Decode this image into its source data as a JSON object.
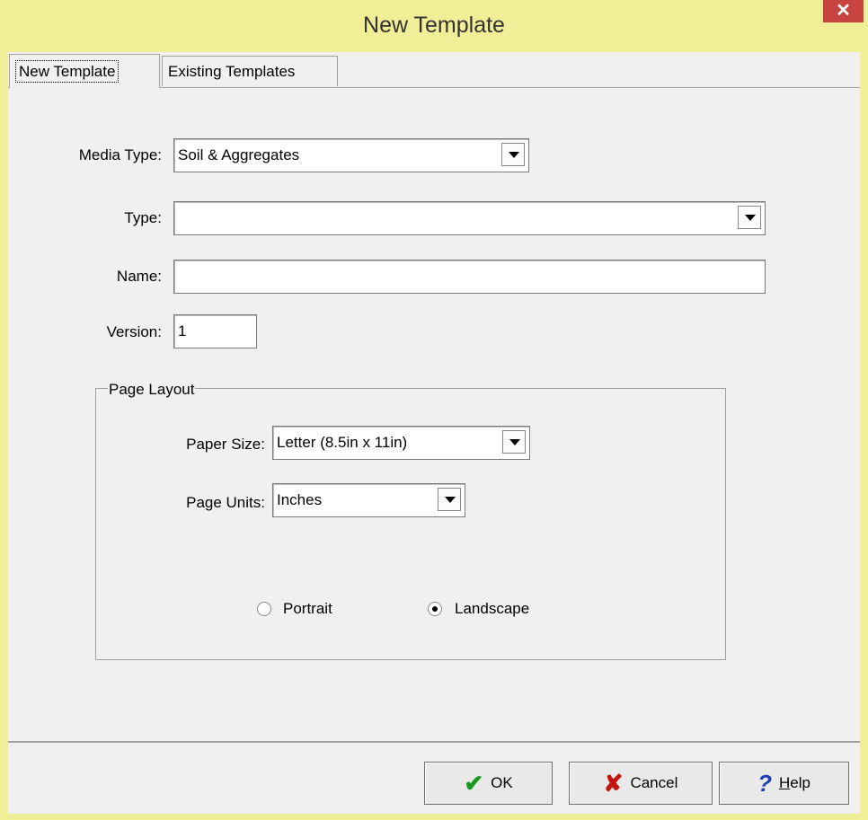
{
  "window": {
    "title": "New Template",
    "close_glyph": "✕"
  },
  "tabs": [
    {
      "label": "New Template",
      "selected": true
    },
    {
      "label": "Existing Templates",
      "selected": false
    }
  ],
  "form": {
    "media_type": {
      "label": "Media Type:",
      "value": "Soil & Aggregates"
    },
    "type": {
      "label": "Type:",
      "value": ""
    },
    "name": {
      "label": "Name:",
      "value": ""
    },
    "version": {
      "label": "Version:",
      "value": "1"
    }
  },
  "page_layout": {
    "title": "Page Layout",
    "paper_size": {
      "label": "Paper Size:",
      "value": "Letter (8.5in x 11in)"
    },
    "page_units": {
      "label": "Page Units:",
      "value": "Inches"
    },
    "orientation": {
      "portrait": {
        "label": "Portrait",
        "checked": false
      },
      "landscape": {
        "label": "Landscape",
        "checked": true
      }
    }
  },
  "buttons": {
    "ok": {
      "label": "OK",
      "icon": "checkmark-icon"
    },
    "cancel": {
      "label": "Cancel",
      "icon": "x-icon"
    },
    "help": {
      "label_first": "H",
      "label_rest": "elp",
      "icon": "question-mark-icon"
    }
  },
  "colors": {
    "title_bar": "#f0ee96",
    "dialog": "#f0f0f0",
    "close_button": "#c7433f"
  }
}
